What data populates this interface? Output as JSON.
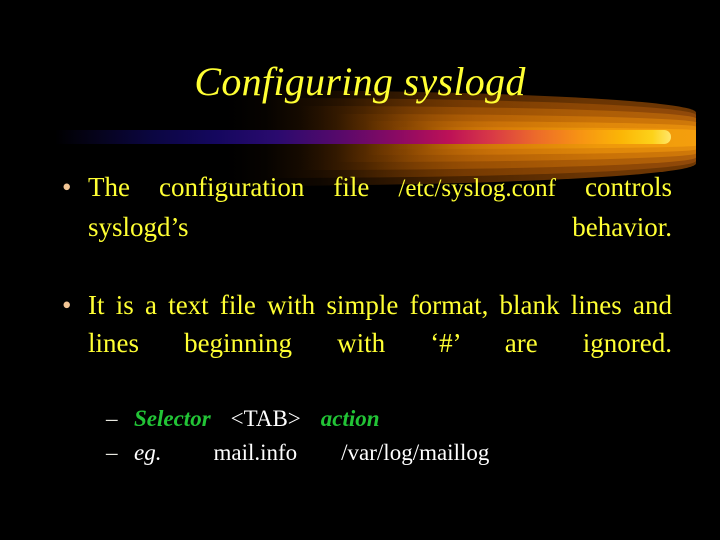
{
  "slide": {
    "title": "Configuring syslogd",
    "background_color": "#000000",
    "title_color": "#ffff33",
    "body_color": "#ffff33",
    "accent_green": "#22c436",
    "sub_text_color": "#ffffff",
    "bullet_marker_color": "#f2c595",
    "bullets": [
      {
        "marker": "•",
        "text_before_path": "The configuration file ",
        "path": "/etc/syslog.conf",
        "text_after_path": " controls syslogd’s behavior.",
        "full_text": "The configuration file /etc/syslog.conf controls syslogd’s behavior."
      },
      {
        "marker": "•",
        "full_text": "It is a text file with simple format, blank lines and lines beginning with ‘#’ are ignored."
      }
    ],
    "sub_bullets": [
      {
        "marker": "–",
        "keyword": "Selector",
        "token": "<TAB>",
        "keyword2": "action"
      },
      {
        "marker": "–",
        "label": "eg.",
        "value1": "mail.info",
        "value2": "/var/log/maillog"
      }
    ]
  }
}
